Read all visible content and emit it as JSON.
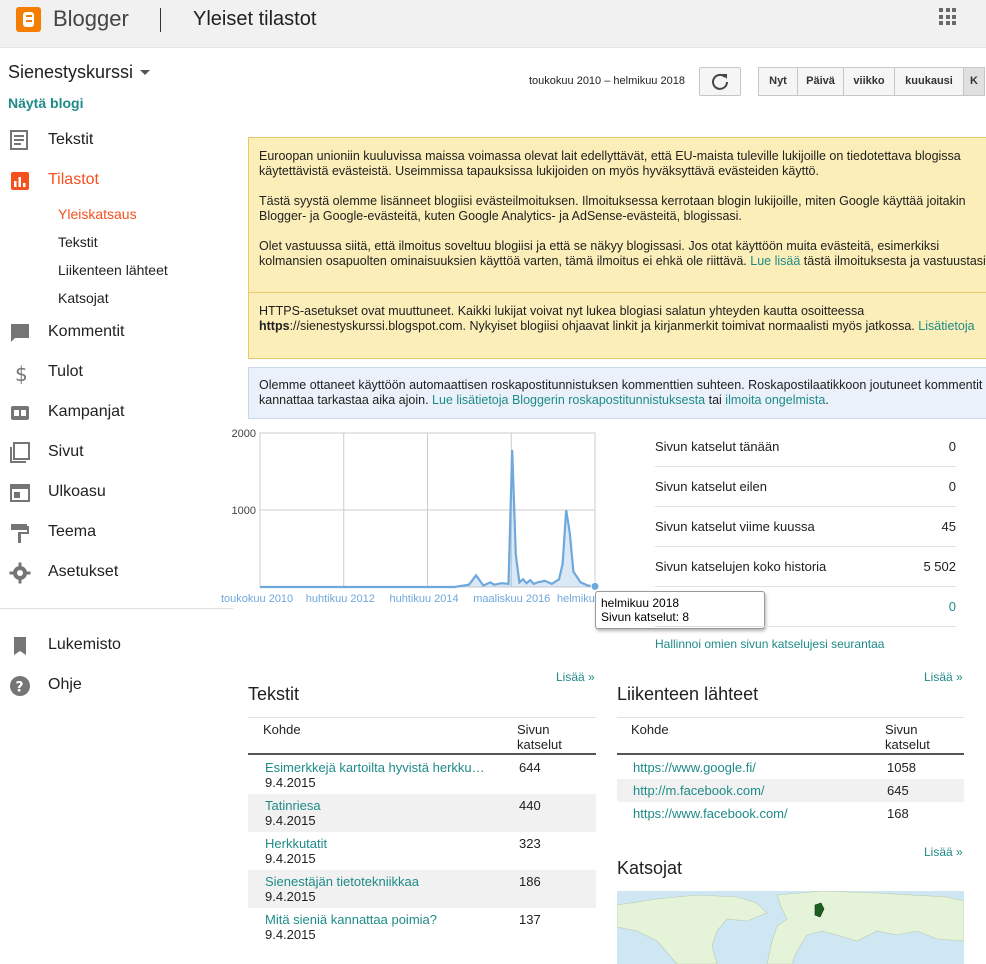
{
  "header": {
    "app_name": "Blogger",
    "page_title": "Yleiset tilastot",
    "apps_icon": "apps-grid-icon",
    "brand_color": "#f57d00"
  },
  "sidebar": {
    "blog_name": "Sienestyskurssi",
    "view_blog": "Näytä blogi",
    "items": [
      {
        "label": "Tekstit",
        "icon": "posts-icon"
      },
      {
        "label": "Tilastot",
        "icon": "stats-icon"
      },
      {
        "label": "Kommentit",
        "icon": "comments-icon"
      },
      {
        "label": "Tulot",
        "icon": "dollar-icon"
      },
      {
        "label": "Kampanjat",
        "icon": "campaigns-icon"
      },
      {
        "label": "Sivut",
        "icon": "pages-icon"
      },
      {
        "label": "Ulkoasu",
        "icon": "layout-icon"
      },
      {
        "label": "Teema",
        "icon": "theme-icon"
      },
      {
        "label": "Asetukset",
        "icon": "settings-icon"
      },
      {
        "label": "Lukemisto",
        "icon": "bookmark-icon"
      },
      {
        "label": "Ohje",
        "icon": "help-icon"
      }
    ],
    "stats_sub": [
      {
        "label": "Yleiskatsaus"
      },
      {
        "label": "Tekstit"
      },
      {
        "label": "Liikenteen lähteet"
      },
      {
        "label": "Katsojat"
      }
    ]
  },
  "controls": {
    "date_range": "toukokuu 2010 – helmikuu 2018",
    "periods": [
      "Nyt",
      "Päivä",
      "viikko",
      "kuukausi",
      "K"
    ]
  },
  "notices": {
    "eu_p1": "Euroopan unioniin kuuluvissa maissa voimassa olevat lait edellyttävät, että EU-maista tuleville lukijoille on tiedotettava blogissa käytettävistä evästeistä. Useimmissa tapauksissa lukijoiden on myös hyväksyttävä evästeiden käyttö.",
    "eu_p2": "Tästä syystä olemme lisänneet blogiisi evästeilmoituksen. Ilmoituksessa kerrotaan blogin lukijoille, miten Google käyttää joitakin Blogger- ja Google-evästeitä, kuten Google Analytics- ja AdSense-evästeitä, blogissasi.",
    "eu_p3_a": "Olet vastuussa siitä, että ilmoitus soveltuu blogiisi ja että se näkyy blogissasi. Jos otat käyttöön muita evästeitä, esimerkiksi kolmansien osapuolten ominaisuuksien käyttöä varten, tämä ilmoitus ei ehkä ole riittävä.",
    "eu_p3_link": "Lue lisää",
    "eu_p3_b": "tästä ilmoituksesta ja vastuustasi.",
    "https_a": "HTTPS-asetukset ovat muuttuneet. Kaikki lukijat voivat nyt lukea blogiasi salatun yhteyden kautta osoitteessa",
    "https_bold": "https",
    "https_b": "://sienestyskurssi.blogspot.com. Nykyiset blogiisi ohjaavat linkit ja kirjanmerkit toimivat normaalisti myös jatkossa.",
    "https_link": "Lisätietoja",
    "spam_a": "Olemme ottaneet käyttöön automaattisen roskapostitunnistuksen kommenttien suhteen. Roskapostilaatikkoon joutuneet kommentit kannattaa tarkastaa aika ajoin.",
    "spam_link1": "Lue lisätietoja Bloggerin roskapostitunnistuksesta",
    "spam_mid": "tai",
    "spam_link2": "ilmoita ongelmista",
    "spam_end": "."
  },
  "chart_data": {
    "type": "line",
    "ylim": [
      0,
      2000
    ],
    "yticks": [
      "2000",
      "1000"
    ],
    "xticks": [
      "toukokuu 2010",
      "huhtikuu 2012",
      "huhtikuu 2014",
      "maaliskuu 2016",
      "helmikuu 2018"
    ],
    "x": [
      "2010-05",
      "2010-11",
      "2011-05",
      "2011-11",
      "2012-05",
      "2012-11",
      "2013-05",
      "2013-11",
      "2014-05",
      "2014-11",
      "2015-03",
      "2015-05",
      "2015-07",
      "2015-08",
      "2015-09",
      "2015-10",
      "2015-12",
      "2016-02",
      "2016-03",
      "2016-04",
      "2016-05",
      "2016-06",
      "2016-07",
      "2016-08",
      "2016-09",
      "2016-10",
      "2016-12",
      "2017-02",
      "2017-04",
      "2017-05",
      "2017-06",
      "2017-07",
      "2017-08",
      "2017-10",
      "2017-12",
      "2018-02"
    ],
    "series": [
      {
        "values": [
          0,
          0,
          0,
          0,
          0,
          0,
          0,
          0,
          0,
          0,
          30,
          150,
          20,
          40,
          60,
          30,
          50,
          40,
          1780,
          420,
          60,
          100,
          50,
          90,
          40,
          60,
          80,
          40,
          100,
          300,
          1000,
          700,
          200,
          60,
          20,
          8
        ]
      }
    ],
    "color": "#6fa8dc",
    "tooltip_date": "helmikuu 2018",
    "tooltip_value": "Sivun katselut: 8"
  },
  "stats": [
    {
      "label": "Sivun katselut tänään",
      "value": "0"
    },
    {
      "label": "Sivun katselut eilen",
      "value": "0"
    },
    {
      "label": "Sivun katselut viime kuussa",
      "value": "45"
    },
    {
      "label": "Sivun katselujen koko historia",
      "value": "5 502"
    },
    {
      "label": "",
      "value": "0"
    }
  ],
  "manage_link": "Hallinnoi omien sivun katselujesi seurantaa",
  "posts": {
    "title": "Tekstit",
    "more": "Lisää »",
    "col1": "Kohde",
    "col2": "Sivun katselut",
    "rows": [
      {
        "title": "Esimerkkejä kartoilta hyvistä herkkusienipaikoista",
        "date": "9.4.2015",
        "views": "644"
      },
      {
        "title": "Tatinriesa",
        "date": "9.4.2015",
        "views": "440"
      },
      {
        "title": "Herkkutatit",
        "date": "9.4.2015",
        "views": "323"
      },
      {
        "title": "Sienestäjän tietotekniikkaa",
        "date": "9.4.2015",
        "views": "186"
      },
      {
        "title": "Mitä sieniä kannattaa poimia?",
        "date": "9.4.2015",
        "views": "137"
      }
    ]
  },
  "traffic": {
    "title": "Liikenteen lähteet",
    "more": "Lisää »",
    "col1": "Kohde",
    "col2": "Sivun katselut",
    "rows": [
      {
        "url": "https://www.google.fi/",
        "views": "1058"
      },
      {
        "url": "http://m.facebook.com/",
        "views": "645"
      },
      {
        "url": "https://www.facebook.com/",
        "views": "168"
      }
    ]
  },
  "audience": {
    "title": "Katsojat",
    "more": "Lisää »"
  }
}
